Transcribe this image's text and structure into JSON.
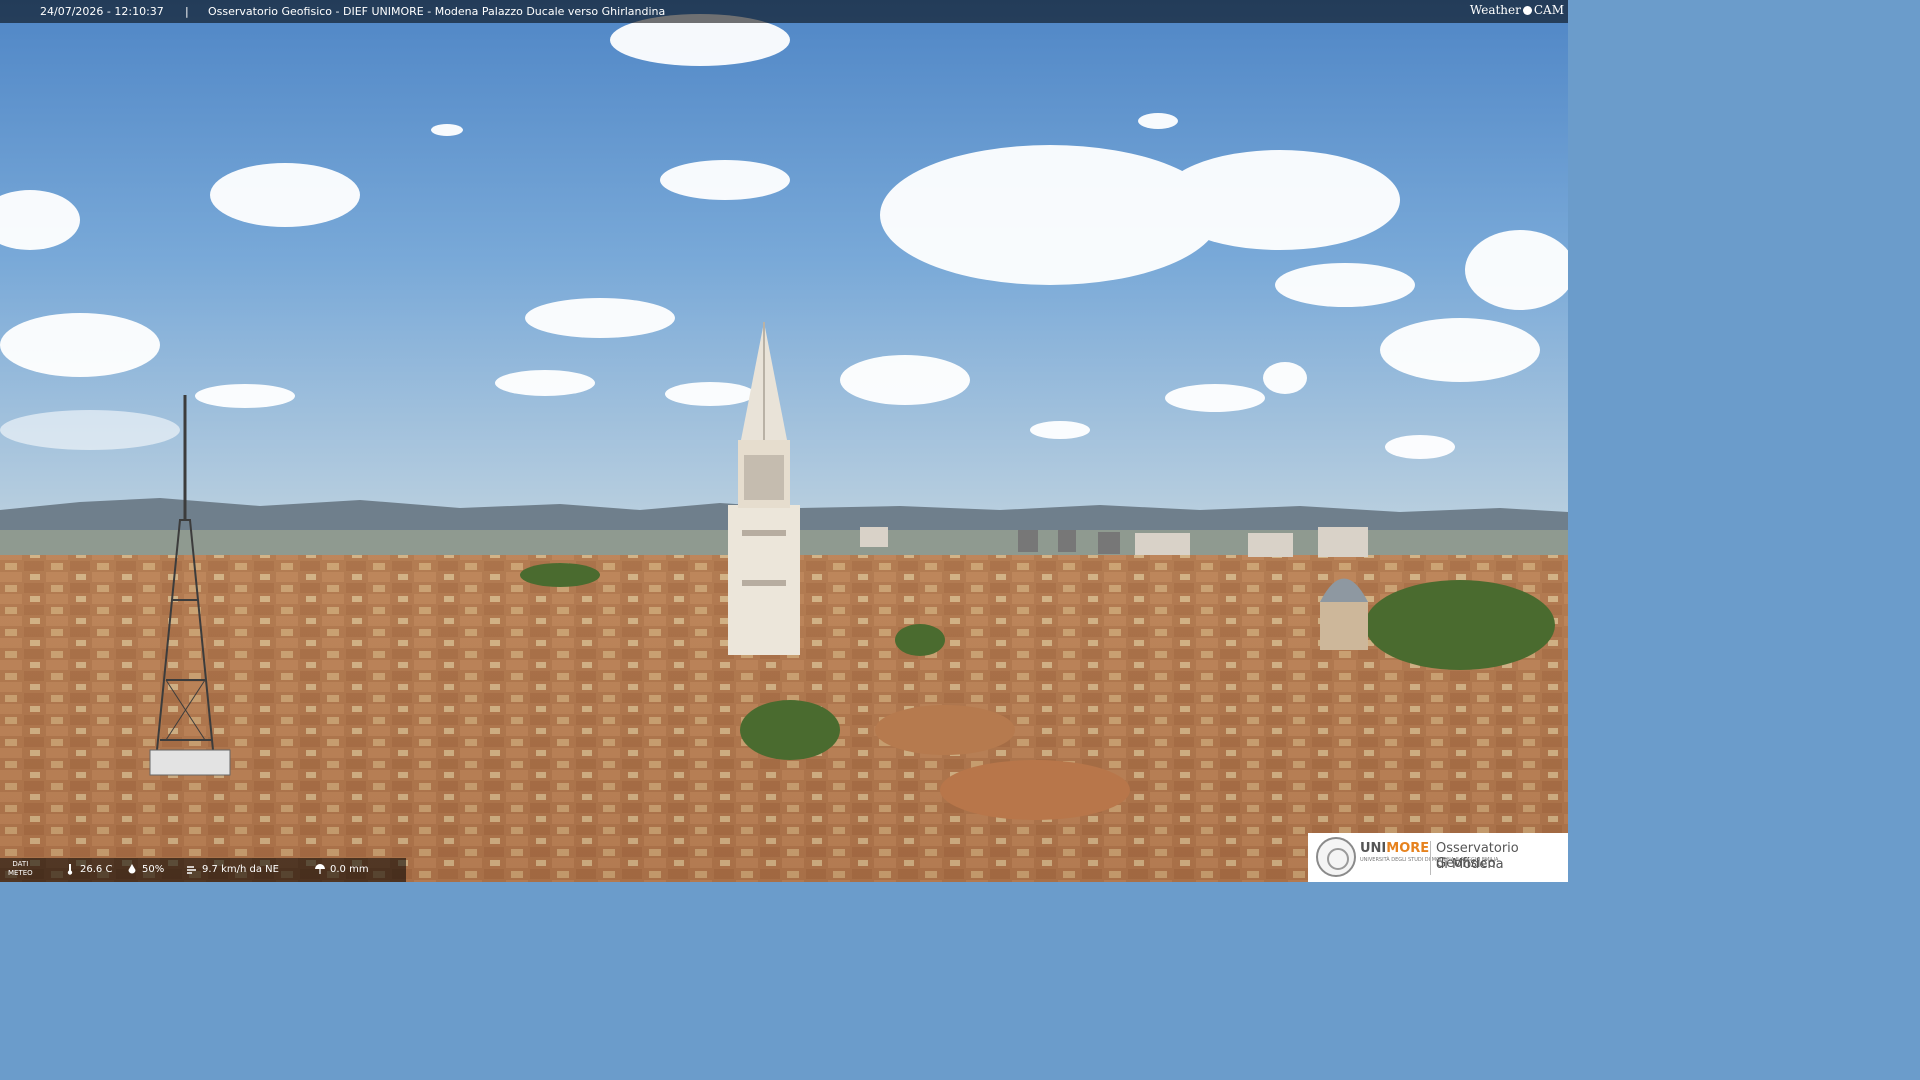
{
  "header": {
    "timestamp": "24/07/2026 - 12:10:37",
    "separator": "|",
    "title": "Osservatorio Geofisico - DIEF UNIMORE - Modena Palazzo Ducale verso Ghirlandina",
    "brand_left": "Weather",
    "brand_right": "CAM"
  },
  "weather": {
    "label_line1": "DATI",
    "label_line2": "METEO",
    "temperature": "26.6 C",
    "humidity": "50%",
    "wind": "9.7 km/h da NE",
    "rain": "0.0 mm"
  },
  "logo": {
    "uni_a": "UNI",
    "uni_b": "MORE",
    "uni_sub": "UNIVERSITÀ DEGLI STUDI DI MODENA E REGGIO EMILIA",
    "obs_line1": "Osservatorio Geofisico",
    "obs_line2": "di Modena"
  },
  "colors": {
    "accent": "#e6821e",
    "bar": "#000000"
  }
}
